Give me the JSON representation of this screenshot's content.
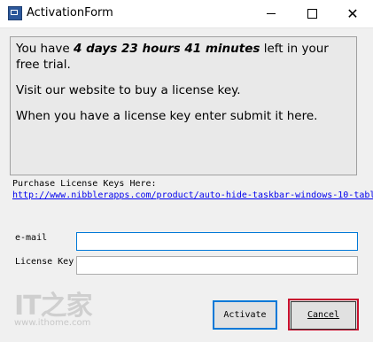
{
  "window": {
    "title": "ActivationForm",
    "icon": "app-window-icon",
    "controls": {
      "minimize": "minimize-icon",
      "maximize": "maximize-icon",
      "close": "close-icon"
    }
  },
  "message": {
    "trial_prefix": "You have ",
    "trial_time": "4 days 23 hours 41 minutes",
    "trial_suffix": " left in your free trial.",
    "line2": "Visit our website to buy a license key.",
    "line3": "When you have a license key enter submit it here."
  },
  "purchase": {
    "label": "Purchase License Keys Here:",
    "link": "http://www.nibblerapps.com/product/auto-hide-taskbar-windows-10-tabl"
  },
  "form": {
    "email_label": "e-mail",
    "email_value": "",
    "license_label": "License Key",
    "license_value": ""
  },
  "buttons": {
    "activate": "Activate",
    "cancel": "Cancel"
  },
  "watermark": {
    "logo": "IT之家",
    "url": "www.ithome.com"
  },
  "colors": {
    "focus": "#0078d7",
    "highlight": "#c8102e",
    "link": "#0000ee"
  }
}
